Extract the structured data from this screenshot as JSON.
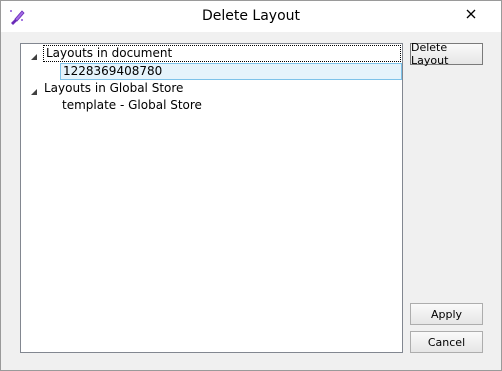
{
  "window": {
    "title": "Delete Layout",
    "app_icon": "brush-icon",
    "close_icon": "close-icon"
  },
  "tree": {
    "nodes": [
      {
        "label": "Layouts in document",
        "expanded": true,
        "children": [
          {
            "label": "1228369408780",
            "selected": true
          }
        ]
      },
      {
        "label": "Layouts in Global Store",
        "expanded": true,
        "children": [
          {
            "label": "template - Global Store",
            "selected": false
          }
        ]
      }
    ]
  },
  "buttons": {
    "delete_layout": "Delete Layout",
    "apply": "Apply",
    "cancel": "Cancel"
  },
  "colors": {
    "selection_fill": "#e5f3fb",
    "selection_border": "#7dc2e9",
    "icon_purple": "#8a4fd8"
  }
}
